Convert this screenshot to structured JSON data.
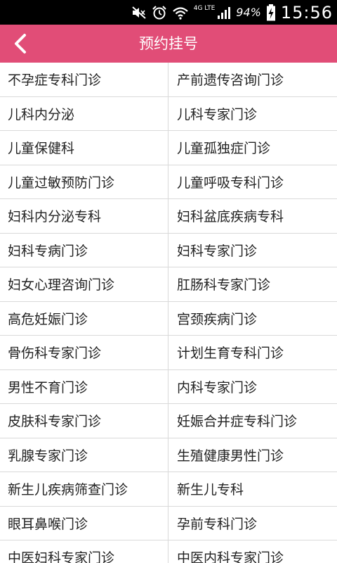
{
  "status_bar": {
    "network": "4G LTE",
    "battery": "94%",
    "time": "15:56",
    "icons": [
      "muted-icon",
      "alarm-icon",
      "wifi-icon",
      "signal-icon",
      "battery-charging-icon"
    ]
  },
  "header": {
    "title": "预约挂号",
    "back_icon": "chevron-left-icon",
    "color": "#e14d77"
  },
  "departments": [
    [
      "不孕症专科门诊",
      "产前遗传咨询门诊"
    ],
    [
      "儿科内分泌",
      "儿科专家门诊"
    ],
    [
      "儿童保健科",
      "儿童孤独症门诊"
    ],
    [
      "儿童过敏预防门诊",
      "儿童呼吸专科门诊"
    ],
    [
      "妇科内分泌专科",
      "妇科盆底疾病专科"
    ],
    [
      "妇科专病门诊",
      "妇科专家门诊"
    ],
    [
      "妇女心理咨询门诊",
      "肛肠科专家门诊"
    ],
    [
      "高危妊娠门诊",
      "宫颈疾病门诊"
    ],
    [
      "骨伤科专家门诊",
      "计划生育专科门诊"
    ],
    [
      "男性不育门诊",
      "内科专家门诊"
    ],
    [
      "皮肤科专家门诊",
      "妊娠合并症专科门诊"
    ],
    [
      "乳腺专家门诊",
      "生殖健康男性门诊"
    ],
    [
      "新生儿疾病筛查门诊",
      "新生儿专科"
    ],
    [
      "眼耳鼻喉门诊",
      "孕前专科门诊"
    ],
    [
      "中医妇科专家门诊",
      "中医内科专家门诊"
    ]
  ]
}
